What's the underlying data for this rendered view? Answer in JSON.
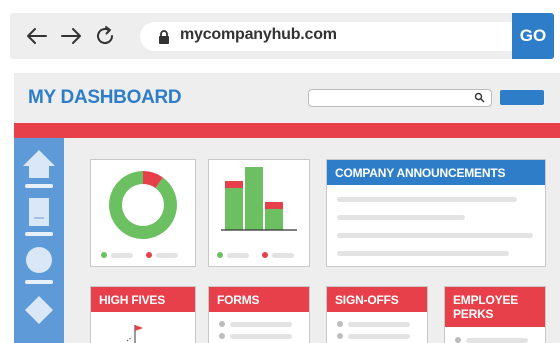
{
  "browser": {
    "url": "mycompanyhub.com",
    "go_label": "GO"
  },
  "app": {
    "title": "MY DASHBOARD"
  },
  "cards": {
    "announcements_title": "COMPANY ANNOUNCEMENTS",
    "high_fives_title": "HIGH FIVES",
    "forms_title": "FORMS",
    "signoffs_title": "SIGN-OFFS",
    "perks_title": "EMPLOYEE PERKS"
  },
  "colors": {
    "accent_blue": "#2e7dc9",
    "accent_red": "#e8404a",
    "chart_green": "#6cc062",
    "sidebar_blue": "#5f9ad8"
  },
  "chart_data": [
    {
      "type": "pie",
      "values": [
        0.9,
        0.1
      ]
    },
    {
      "type": "bar",
      "categories": [
        "",
        "",
        ""
      ],
      "series": [
        {
          "values": [
            6,
            9,
            3
          ]
        },
        {
          "values": [
            1,
            0,
            1
          ]
        }
      ]
    }
  ]
}
